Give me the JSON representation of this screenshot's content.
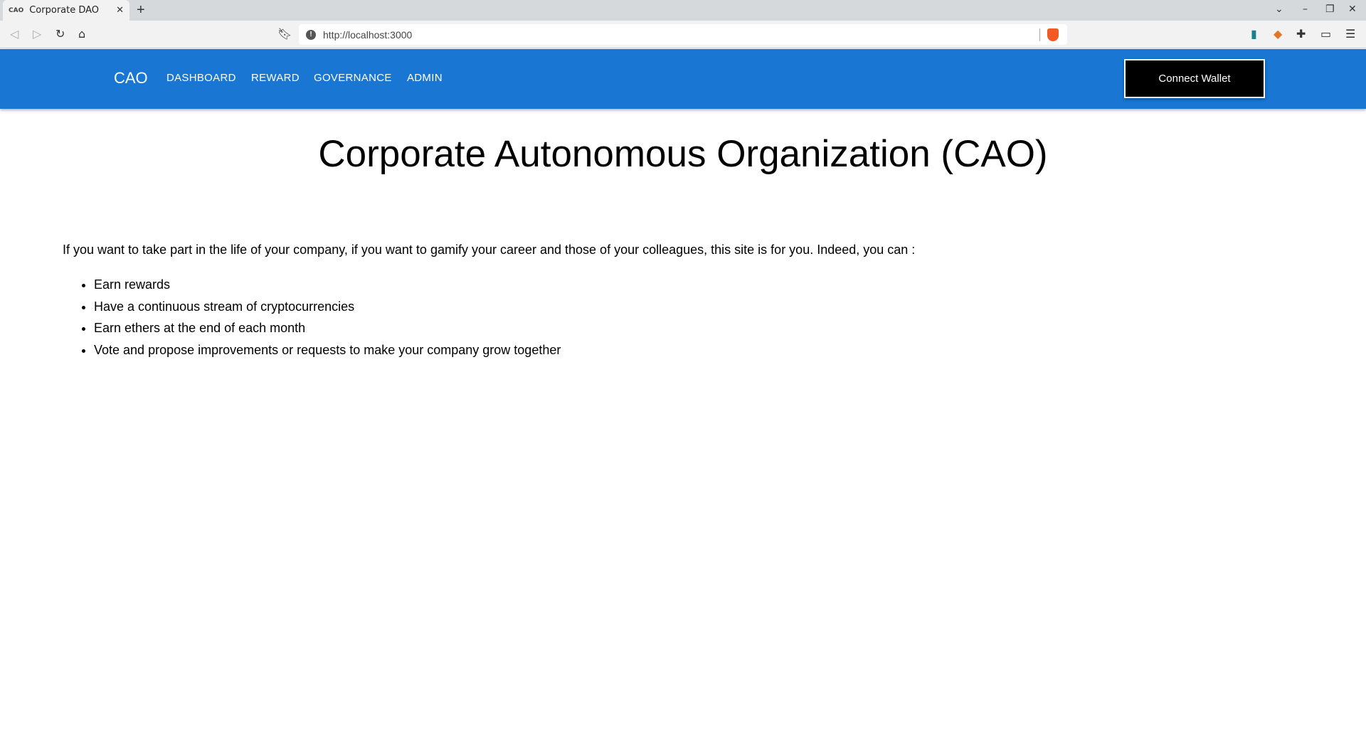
{
  "browser": {
    "tab_title": "Corporate DAO",
    "favicon_text": "CAO",
    "url": "http://localhost:3000"
  },
  "navbar": {
    "brand": "CAO",
    "links": [
      "DASHBOARD",
      "REWARD",
      "GOVERNANCE",
      "ADMIN"
    ],
    "connect_label": "Connect Wallet",
    "color": "#1976d2"
  },
  "main": {
    "title": "Corporate Autonomous Organization (CAO)",
    "intro": "If you want to take part in the life of your company, if you want to gamify your career and those of your colleagues, this site is for you. Indeed, you can :",
    "features": [
      "Earn rewards",
      "Have a continuous stream of cryptocurrencies",
      "Earn ethers at the end of each month",
      "Vote and propose improvements or requests to make your company grow together"
    ]
  }
}
